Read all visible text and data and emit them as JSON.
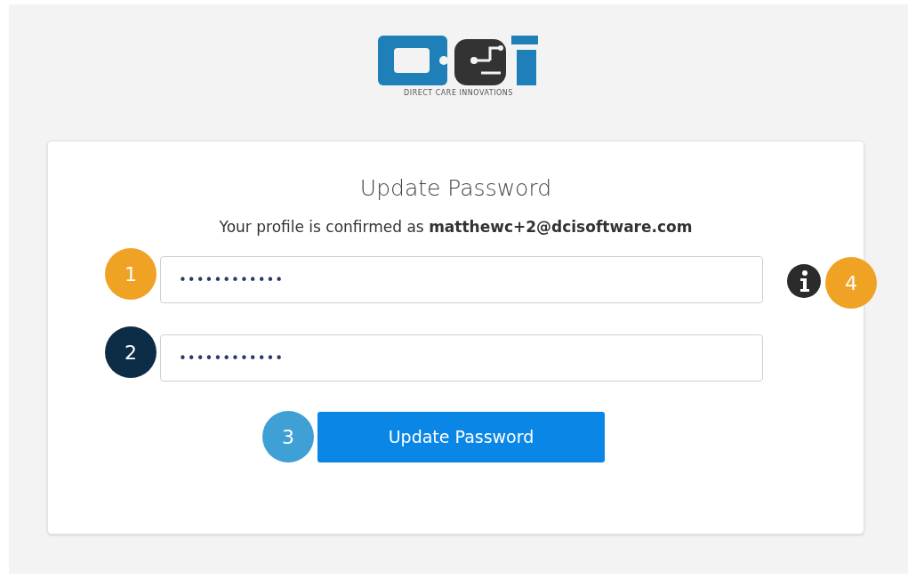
{
  "logo": {
    "tagline": "DIRECT CARE INNOVATIONS"
  },
  "title": "Update Password",
  "subtitle": "Your profile is confirmed as **matthewc+2@dcisoftware.com**",
  "fields": [
    {
      "value": "••••••••••••",
      "callout": {
        "label": "1",
        "color": "#f0a225"
      }
    },
    {
      "value": "••••••••••••",
      "callout": {
        "label": "2",
        "color": "#0d2c45"
      }
    }
  ],
  "info_callout": {
    "label": "4",
    "color": "#f0a225"
  },
  "button": {
    "label": "Update Password",
    "callout": {
      "label": "3",
      "color": "#3ea0d5"
    }
  }
}
